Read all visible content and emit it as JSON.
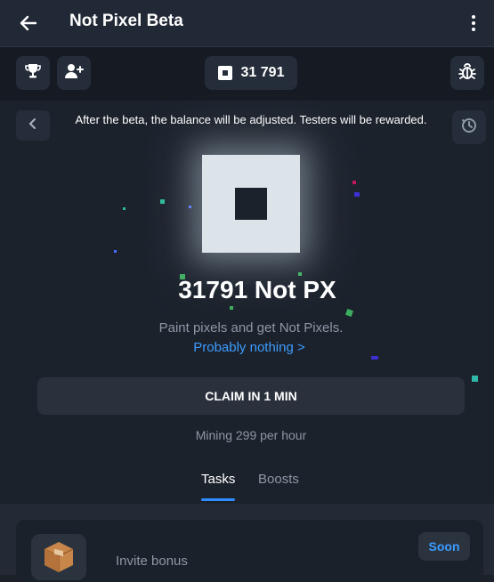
{
  "header": {
    "title": "Not Pixel Beta"
  },
  "toolbar": {
    "balance": "31 791"
  },
  "notice": "After the beta, the balance will be adjusted. Testers will be rewarded.",
  "main": {
    "points": "31791 Not PX",
    "subtitle": "Paint pixels and get Not Pixels.",
    "link": "Probably nothing",
    "link_chevron": ">",
    "claim_label": "CLAIM IN 1 MIN",
    "mining_rate": "Mining 299 per hour"
  },
  "tabs": [
    {
      "label": "Tasks",
      "active": true
    },
    {
      "label": "Boosts",
      "active": false
    }
  ],
  "task": {
    "label": "Invite bonus",
    "action": "Soon"
  },
  "colors": {
    "accent": "#3b9cff",
    "background": "#1c222c",
    "panel": "#252d3a"
  },
  "icons": [
    "back-arrow-icon",
    "more-vertical-icon",
    "trophy-icon",
    "add-user-icon",
    "pixel-icon",
    "bug-icon",
    "chevron-left-icon",
    "history-icon",
    "package-icon"
  ]
}
